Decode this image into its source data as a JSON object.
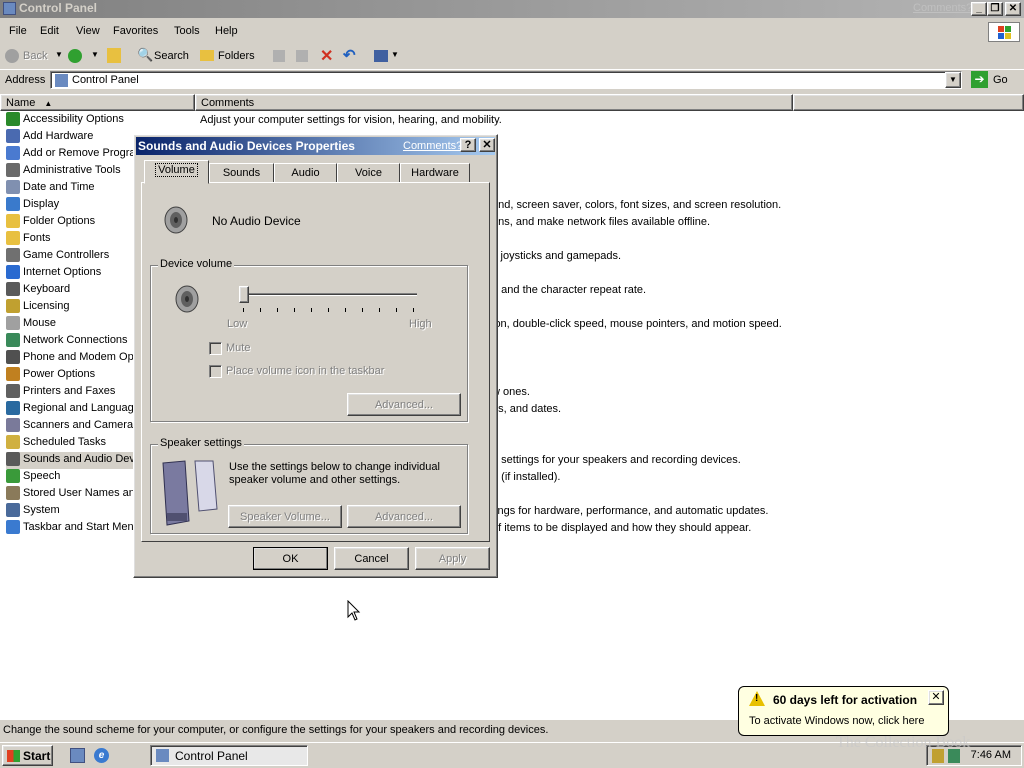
{
  "window": {
    "title": "Control Panel",
    "comments_link": "Comments?",
    "menu": [
      "File",
      "Edit",
      "View",
      "Favorites",
      "Tools",
      "Help"
    ],
    "toolbar": {
      "back": "Back",
      "search": "Search",
      "folders": "Folders"
    },
    "address_label": "Address",
    "address_value": "Control Panel",
    "go_label": "Go"
  },
  "list": {
    "col_name": "Name",
    "col_comments": "Comments",
    "items": [
      {
        "name": "Accessibility Options",
        "comment": "Adjust your computer settings for vision, hearing, and mobility.",
        "color": "#2a8a2a"
      },
      {
        "name": "Add Hardware",
        "comment": "",
        "color": "#4a6ab0"
      },
      {
        "name": "Add or Remove Progra",
        "comment": "",
        "color": "#4a7ad0"
      },
      {
        "name": "Administrative Tools",
        "comment": "",
        "color": "#6a6a6a"
      },
      {
        "name": "Date and Time",
        "comment": "",
        "color": "#8090b0"
      },
      {
        "name": "Display",
        "comment": "und, screen saver, colors, font sizes, and screen resolution.",
        "color": "#3a7acc"
      },
      {
        "name": "Folder Options",
        "comment": "ons, and make network files available offline.",
        "color": "#e8c040"
      },
      {
        "name": "Fonts",
        "comment": "",
        "color": "#e8c040"
      },
      {
        "name": "Game Controllers",
        "comment": "s joysticks and gamepads.",
        "color": "#707070"
      },
      {
        "name": "Internet Options",
        "comment": "",
        "color": "#2a6ad0"
      },
      {
        "name": "Keyboard",
        "comment": "e and the character repeat rate.",
        "color": "#5a5a5a"
      },
      {
        "name": "Licensing",
        "comment": "",
        "color": "#c0a030"
      },
      {
        "name": "Mouse",
        "comment": "ion, double-click speed, mouse pointers, and motion speed.",
        "color": "#a0a0a0"
      },
      {
        "name": "Network Connections",
        "comment": "",
        "color": "#3a8a5a"
      },
      {
        "name": "Phone and Modem Opt",
        "comment": "",
        "color": "#505050"
      },
      {
        "name": "Power Options",
        "comment": "",
        "color": "#c08020"
      },
      {
        "name": "Printers and Faxes",
        "comment": "w ones.",
        "color": "#606060"
      },
      {
        "name": "Regional and Language",
        "comment": "es, and dates.",
        "color": "#2a6aa0"
      },
      {
        "name": "Scanners and Cameras",
        "comment": "",
        "color": "#7a7a9a"
      },
      {
        "name": "Scheduled Tasks",
        "comment": "",
        "color": "#d0b040"
      },
      {
        "name": "Sounds and Audio Dev",
        "comment": "e settings for your speakers and recording devices.",
        "color": "#5a5a5a"
      },
      {
        "name": "Speech",
        "comment": "n (if installed).",
        "color": "#3a9a3a"
      },
      {
        "name": "Stored User Names an",
        "comment": "",
        "color": "#8a7a5a"
      },
      {
        "name": "System",
        "comment": "tings for hardware, performance, and automatic updates.",
        "color": "#4a6a9a"
      },
      {
        "name": "Taskbar and Start Men",
        "comment": "of items to be displayed and how they should appear.",
        "color": "#3a7ad0"
      }
    ]
  },
  "status_text": "Change the sound scheme for your computer, or configure the settings for your speakers and recording devices.",
  "taskbar": {
    "start": "Start",
    "task_button": "Control Panel",
    "clock": "7:46 AM"
  },
  "balloon": {
    "title": "60 days left for activation",
    "body": "To activate Windows now, click here",
    "watermark": "The Collection Book"
  },
  "dialog": {
    "title": "Sounds and Audio Devices Properties",
    "comments": "Comments?",
    "tabs": [
      "Volume",
      "Sounds",
      "Audio",
      "Voice",
      "Hardware"
    ],
    "device_name": "No Audio Device",
    "device_volume_label": "Device volume",
    "low": "Low",
    "high": "High",
    "volume_level": 0,
    "mute": "Mute",
    "place_icon": "Place volume icon in the taskbar",
    "advanced": "Advanced...",
    "speaker_settings_label": "Speaker settings",
    "speaker_text": "Use the settings below to change individual speaker volume and other settings.",
    "speaker_volume": "Speaker Volume...",
    "ok": "OK",
    "cancel": "Cancel",
    "apply": "Apply"
  }
}
